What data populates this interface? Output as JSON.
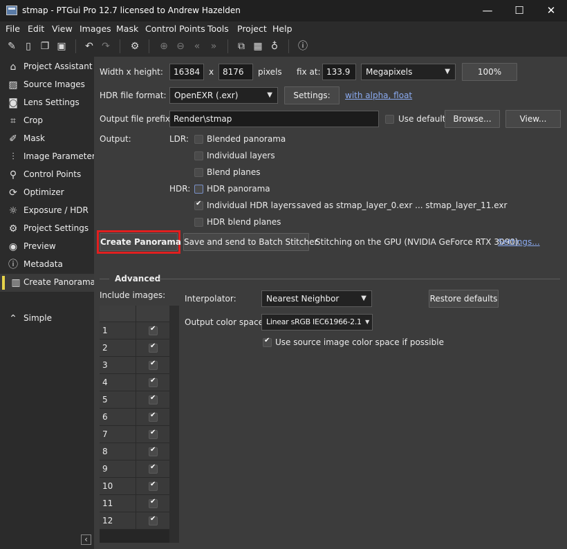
{
  "window": {
    "title": "stmap - PTGui Pro 12.7 licensed to Andrew Hazelden",
    "minimize": "—",
    "maximize": "☐",
    "close": "✕"
  },
  "menu": [
    "File",
    "Edit",
    "View",
    "Images",
    "Mask",
    "Control Points",
    "Tools",
    "Project",
    "Help"
  ],
  "toolbar_icons": [
    "edit-icon",
    "new-doc-icon",
    "copy-doc-icon",
    "save-icon",
    "undo-icon",
    "redo-icon",
    "settings-gear-icon",
    "zoom-in-icon",
    "zoom-out-icon",
    "fit-left-icon",
    "fit-right-icon",
    "panorama-editor-icon",
    "table-icon",
    "light-bulb-icon",
    "help-icon"
  ],
  "sidebar": {
    "items": [
      {
        "label": "Project Assistant",
        "icon": "home-icon"
      },
      {
        "label": "Source Images",
        "icon": "image-icon"
      },
      {
        "label": "Lens Settings",
        "icon": "camera-icon"
      },
      {
        "label": "Crop",
        "icon": "crop-icon"
      },
      {
        "label": "Mask",
        "icon": "brush-icon"
      },
      {
        "label": "Image Parameters",
        "icon": "sliders-icon"
      },
      {
        "label": "Control Points",
        "icon": "control-points-icon"
      },
      {
        "label": "Optimizer",
        "icon": "optimizer-icon"
      },
      {
        "label": "Exposure / HDR",
        "icon": "sun-icon"
      },
      {
        "label": "Project Settings",
        "icon": "gear-icon"
      },
      {
        "label": "Preview",
        "icon": "eye-icon"
      },
      {
        "label": "Metadata",
        "icon": "info-icon"
      },
      {
        "label": "Create Panorama",
        "icon": "book-icon"
      }
    ],
    "active": "Create Panorama",
    "simple_label": "Simple",
    "collapse_glyph": "‹"
  },
  "size": {
    "label": "Width x height:",
    "width": "16384",
    "x": "x",
    "height": "8176",
    "pixels": "pixels",
    "fix_at_label": "fix at:",
    "fix_at_value": "133.9",
    "unit": "Megapixels",
    "percent_button": "100%"
  },
  "hdr_format": {
    "label": "HDR file format:",
    "value": "OpenEXR (.exr)",
    "settings_button": "Settings:",
    "link": "with alpha, float"
  },
  "output_prefix": {
    "label": "Output file prefix:",
    "value": "Render\\stmap",
    "use_default": "Use default",
    "browse": "Browse...",
    "view": "View..."
  },
  "output": {
    "label": "Output:",
    "ldr_label": "LDR:",
    "ldr_options": [
      {
        "label": "Blended panorama",
        "checked": false
      },
      {
        "label": "Individual layers",
        "checked": false
      },
      {
        "label": "Blend planes",
        "checked": false
      }
    ],
    "hdr_label": "HDR:",
    "hdr_options": [
      {
        "label": "HDR panorama",
        "checked": false
      },
      {
        "label": "Individual HDR layers",
        "checked": true
      },
      {
        "label": "HDR blend planes",
        "checked": false
      }
    ],
    "saved_as": "saved as stmap_layer_0.exr ... stmap_layer_11.exr"
  },
  "actions": {
    "create": "Create Panorama",
    "batch": "Save and send to Batch Stitcher",
    "gpu_status": "Stitching on the GPU (NVIDIA GeForce RTX 3090).",
    "gpu_settings_link": "Settings..."
  },
  "advanced": {
    "header": "Advanced",
    "include_images_label": "Include images:",
    "images": [
      {
        "n": "1",
        "checked": true
      },
      {
        "n": "2",
        "checked": true
      },
      {
        "n": "3",
        "checked": true
      },
      {
        "n": "4",
        "checked": true
      },
      {
        "n": "5",
        "checked": true
      },
      {
        "n": "6",
        "checked": true
      },
      {
        "n": "7",
        "checked": true
      },
      {
        "n": "8",
        "checked": true
      },
      {
        "n": "9",
        "checked": true
      },
      {
        "n": "10",
        "checked": true
      },
      {
        "n": "11",
        "checked": true
      },
      {
        "n": "12",
        "checked": true
      }
    ],
    "interpolator_label": "Interpolator:",
    "interpolator_value": "Nearest Neighbor",
    "restore_defaults": "Restore defaults",
    "color_space_label": "Output color space:",
    "color_space_value": "Linear sRGB IEC61966-2.1",
    "use_source_cs": "Use source image color space if possible",
    "use_source_cs_checked": true
  }
}
